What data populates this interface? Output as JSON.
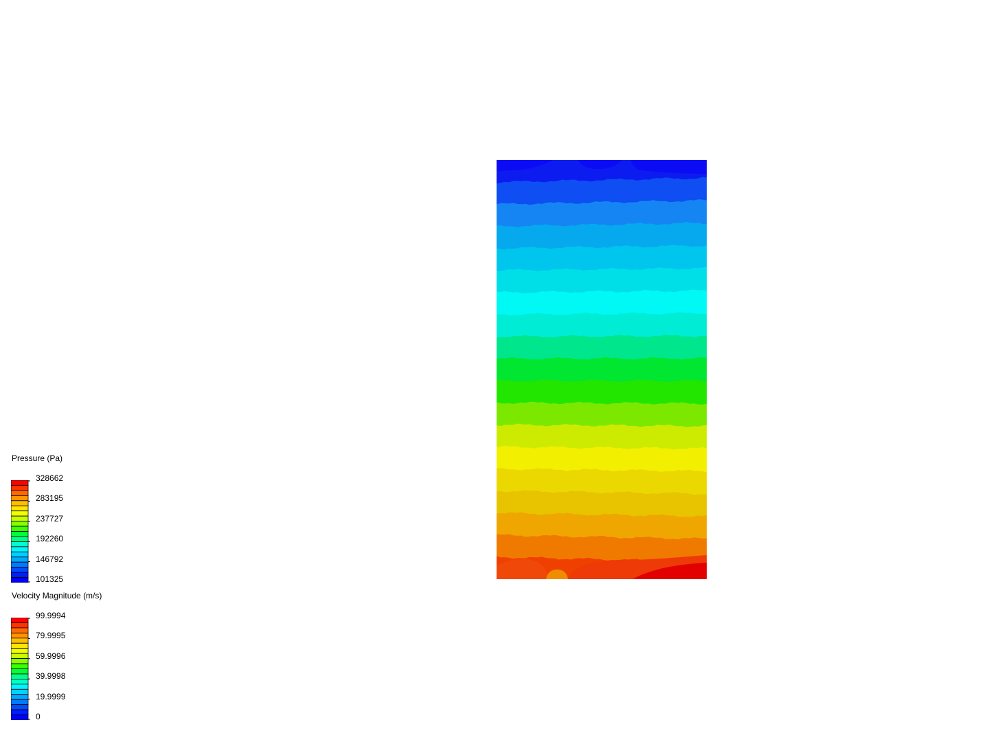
{
  "scene": {
    "contour_colors_top_to_bottom": [
      "#0c1cf0",
      "#0e4ef2",
      "#1585f4",
      "#06a9ee",
      "#00c5ec",
      "#00dfe8",
      "#00f8f5",
      "#00ecd4",
      "#00e68c",
      "#00e631",
      "#22e600",
      "#7ce800",
      "#cdeb00",
      "#f2ef00",
      "#ead800",
      "#e8c300",
      "#f0a600",
      "#f07a00",
      "#f04000"
    ]
  },
  "legends": {
    "pressure": {
      "title": "Pressure (Pa)",
      "labels": [
        "328662",
        "283195",
        "237727",
        "192260",
        "146792",
        "101325"
      ]
    },
    "velocity": {
      "title": "Velocity Magnitude (m/s)",
      "labels": [
        "99.9994",
        "79.9995",
        "59.9996",
        "39.9998",
        "19.9999",
        "0"
      ]
    }
  },
  "colormap_top_to_bottom": [
    "#ff0000",
    "#ff3300",
    "#ff6a00",
    "#ff9400",
    "#ffbe00",
    "#ffe600",
    "#f2ff00",
    "#c8ff00",
    "#88ff00",
    "#3cff00",
    "#00ff37",
    "#00ff8a",
    "#00ffcd",
    "#00f5ff",
    "#00d2ff",
    "#00a8ff",
    "#007aff",
    "#004cff",
    "#001eff",
    "#0000ff"
  ]
}
